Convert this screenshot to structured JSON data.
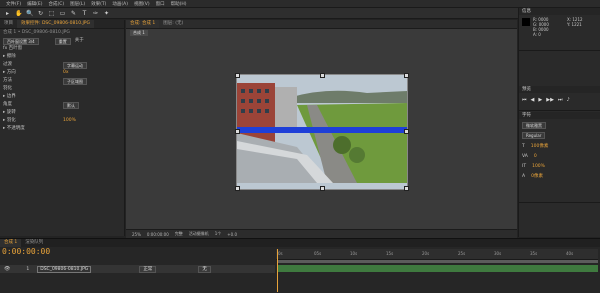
{
  "menu": [
    "文件(F)",
    "编辑(E)",
    "合成(C)",
    "图层(L)",
    "效果(T)",
    "动画(A)",
    "视图(V)",
    "窗口",
    "帮助(H)"
  ],
  "toolbar": {
    "workspace": "工作区",
    "tools": [
      "▸",
      "✋",
      "🔍",
      "↻",
      "⬚",
      "▭",
      "✎",
      "T",
      "✑",
      "✦"
    ]
  },
  "left_panel": {
    "tabs": [
      "项目",
      "效果控件: DSC_09806-0810.JPG"
    ],
    "crumb": "合成 1 • DSC_09806-0810.JPG",
    "effect_name": "百叶窗设置 3/4",
    "reset_label": "重置",
    "about_label": "关于",
    "props": [
      {
        "label": "fx 百叶窗",
        "value": ""
      },
      {
        "label": "▸ 擦除",
        "value": ""
      },
      {
        "label": "  过渡",
        "value": "字幕运动"
      },
      {
        "label": "  ▸ 方向",
        "value": "0x"
      },
      {
        "label": "    方法",
        "value": "子区域图"
      },
      {
        "label": "    羽化",
        "value": ""
      },
      {
        "label": "▸ 边界",
        "value": ""
      },
      {
        "label": "  角度",
        "value": "默认"
      },
      {
        "label": "  ▸ 旋转",
        "value": ""
      },
      {
        "label": "  ▸ 羽化",
        "value": "100%"
      },
      {
        "label": "▸ 不透明度",
        "value": ""
      }
    ]
  },
  "viewer": {
    "tabs": [
      "合成: 合成 1",
      "图层: (无)"
    ],
    "crumb": "合成 1",
    "footer": [
      "25%",
      "0:00:00:00",
      "完整",
      "活动摄像机",
      "1个",
      "+0.0"
    ]
  },
  "right_panel": {
    "info_head": "信息",
    "info_lines": [
      "R: 0000",
      "G: 0000",
      "B: 0000",
      "A: 0"
    ],
    "info_coords": [
      "X: 1212",
      "Y: 1221"
    ],
    "preview_head": "预览",
    "char_head": "字符",
    "char_font": "微软雅黑",
    "char_style": "Regular",
    "char_size": "100像素",
    "char_track": "0",
    "char_scale": "100%",
    "char_baseline": "0像素"
  },
  "timeline": {
    "tabs": [
      "合成 1",
      "渲染队列"
    ],
    "time": "0:00:00:00",
    "layer_name": "DSC_09806-0810.JPG",
    "layer_number": "1",
    "mode": "正常",
    "parent": "无",
    "ruler_ticks": [
      "0s",
      "05s",
      "10s",
      "15s",
      "20s",
      "25s",
      "30s",
      "35s",
      "40s"
    ]
  },
  "colors": {
    "accent": "#e8a33a",
    "blue_bar": "#1e3fd8",
    "timeline_bar": "#3f7a3f"
  }
}
